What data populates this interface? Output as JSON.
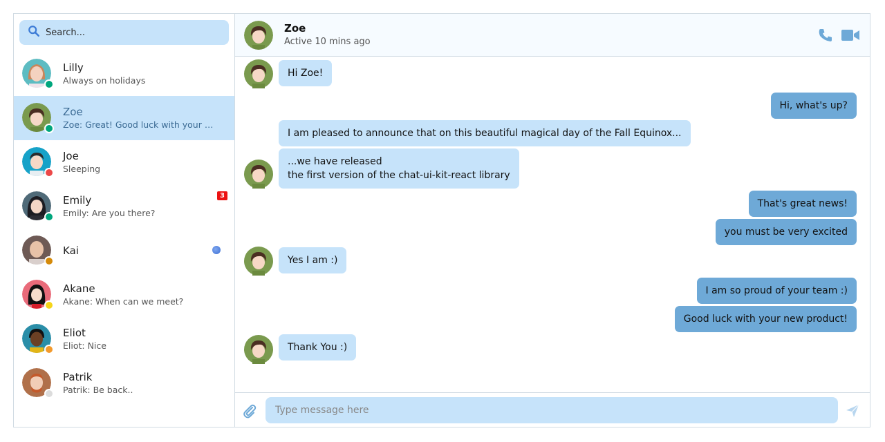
{
  "sidebar": {
    "search_placeholder": "Search...",
    "conversations": [
      {
        "name": "Lilly",
        "info": "Always on holidays",
        "status_color": "#00a67d",
        "active": false
      },
      {
        "name": "Zoe",
        "info": "Zoe: Great! Good luck with your ne...",
        "status_color": "#00a67d",
        "active": true
      },
      {
        "name": "Joe",
        "info": "Sleeping",
        "status_color": "#ec4848",
        "active": false
      },
      {
        "name": "Emily",
        "info": "Emily: Are you there?",
        "status_color": "#00a67d",
        "active": false,
        "badge": "3"
      },
      {
        "name": "Kai",
        "info": "",
        "status_color": "#d58a0a",
        "active": false
      },
      {
        "name": "Akane",
        "info": "Akane: When can we meet?",
        "status_color": "#f5d51a",
        "active": false
      },
      {
        "name": "Eliot",
        "info": "Eliot: Nice",
        "status_color": "#f39a2c",
        "active": false
      },
      {
        "name": "Patrik",
        "info": "Patrik: Be back..",
        "status_color": "#dcdcdc",
        "active": false
      }
    ]
  },
  "header": {
    "name": "Zoe",
    "info": "Active 10 mins ago",
    "icons": [
      "phone-icon",
      "video-icon"
    ]
  },
  "messages": [
    {
      "direction": "in",
      "text": "Hi Zoe!"
    },
    {
      "direction": "out",
      "text": "Hi, what's up?"
    },
    {
      "direction": "in",
      "text": "I am pleased to announce that on this beautiful magical day of the Fall Equinox..."
    },
    {
      "direction": "in",
      "text": "...we have released"
    },
    {
      "direction": "in",
      "text": "the first version of the chat-ui-kit-react library"
    },
    {
      "direction": "out",
      "text": "That's great news!"
    },
    {
      "direction": "out",
      "text": "you must be very excited"
    },
    {
      "direction": "in",
      "text": "Yes I am :)"
    },
    {
      "direction": "out",
      "text": "I am so proud of your team :)"
    },
    {
      "direction": "out",
      "text": "Good luck with your new product!"
    },
    {
      "direction": "in",
      "text": "Thank You :)"
    }
  ],
  "composer": {
    "placeholder": "Type message here",
    "icons": [
      "attachment-icon",
      "send-icon"
    ]
  },
  "colors": {
    "accent": "#6ea9d7",
    "accent_light": "#c6e3fa",
    "unread_badge": "#ec1212"
  }
}
